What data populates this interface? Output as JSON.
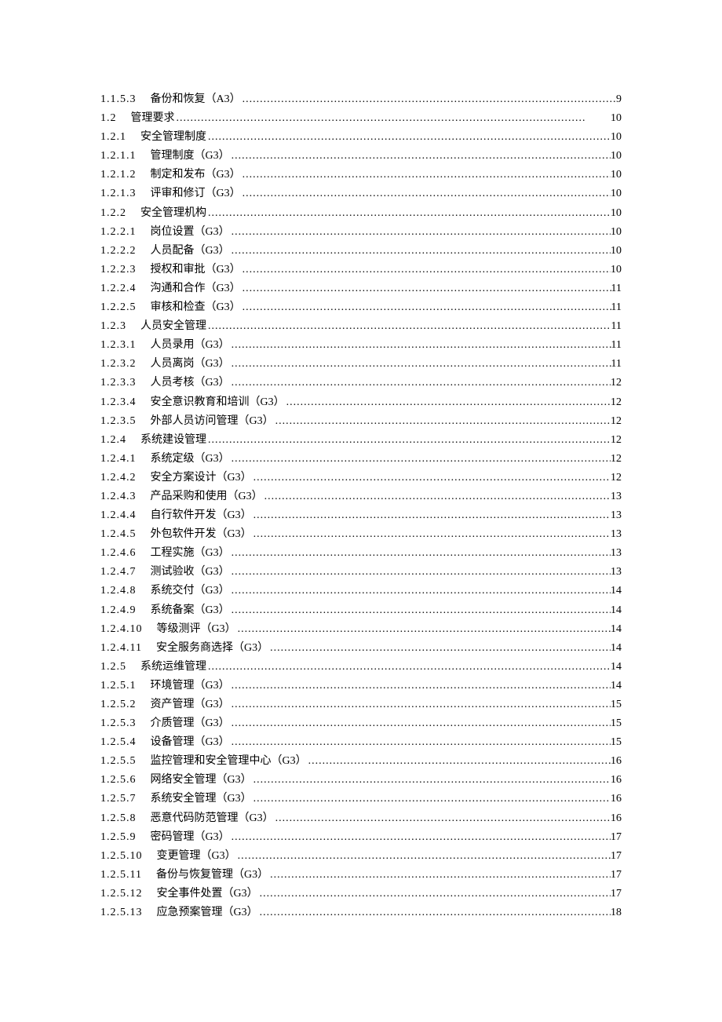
{
  "toc": [
    {
      "num": "1.1.5.3",
      "title": "备份和恢复（A3）",
      "page": "9"
    },
    {
      "num": "1.2",
      "title": "管理要求",
      "page": "10"
    },
    {
      "num": "1.2.1",
      "title": "安全管理制度",
      "page": "10"
    },
    {
      "num": "1.2.1.1",
      "title": "管理制度（G3）",
      "page": "10"
    },
    {
      "num": "1.2.1.2",
      "title": "制定和发布（G3）",
      "page": "10"
    },
    {
      "num": "1.2.1.3",
      "title": "评审和修订（G3）",
      "page": "10"
    },
    {
      "num": "1.2.2",
      "title": "安全管理机构",
      "page": "10"
    },
    {
      "num": "1.2.2.1",
      "title": "岗位设置（G3）",
      "page": "10"
    },
    {
      "num": "1.2.2.2",
      "title": "人员配备（G3）",
      "page": "10"
    },
    {
      "num": "1.2.2.3",
      "title": "授权和审批（G3）",
      "page": "10"
    },
    {
      "num": "1.2.2.4",
      "title": "沟通和合作（G3）",
      "page": "11"
    },
    {
      "num": "1.2.2.5",
      "title": "审核和检查（G3）",
      "page": "11"
    },
    {
      "num": "1.2.3",
      "title": "人员安全管理",
      "page": "11"
    },
    {
      "num": "1.2.3.1",
      "title": "人员录用（G3）",
      "page": "11"
    },
    {
      "num": "1.2.3.2",
      "title": "人员离岗（G3）",
      "page": "11"
    },
    {
      "num": "1.2.3.3",
      "title": "人员考核（G3）",
      "page": "12"
    },
    {
      "num": "1.2.3.4",
      "title": "安全意识教育和培训（G3）",
      "page": "12"
    },
    {
      "num": "1.2.3.5",
      "title": "外部人员访问管理（G3）",
      "page": "12"
    },
    {
      "num": "1.2.4",
      "title": "系统建设管理",
      "page": "12"
    },
    {
      "num": "1.2.4.1",
      "title": "系统定级（G3）",
      "page": "12"
    },
    {
      "num": "1.2.4.2",
      "title": "安全方案设计（G3）",
      "page": "12"
    },
    {
      "num": "1.2.4.3",
      "title": "产品采购和使用（G3）",
      "page": "13"
    },
    {
      "num": "1.2.4.4",
      "title": "自行软件开发（G3）",
      "page": "13"
    },
    {
      "num": "1.2.4.5",
      "title": "外包软件开发（G3）",
      "page": "13"
    },
    {
      "num": "1.2.4.6",
      "title": "工程实施（G3）",
      "page": "13"
    },
    {
      "num": "1.2.4.7",
      "title": "测试验收（G3）",
      "page": "13"
    },
    {
      "num": "1.2.4.8",
      "title": "系统交付（G3）",
      "page": "14"
    },
    {
      "num": "1.2.4.9",
      "title": "系统备案（G3）",
      "page": "14"
    },
    {
      "num": "1.2.4.10",
      "title": "等级测评（G3）",
      "page": "14"
    },
    {
      "num": "1.2.4.11",
      "title": "安全服务商选择（G3）",
      "page": "14"
    },
    {
      "num": "1.2.5",
      "title": "系统运维管理",
      "page": "14"
    },
    {
      "num": "1.2.5.1",
      "title": "环境管理（G3）",
      "page": "14"
    },
    {
      "num": "1.2.5.2",
      "title": "资产管理（G3）",
      "page": "15"
    },
    {
      "num": "1.2.5.3",
      "title": "介质管理（G3）",
      "page": "15"
    },
    {
      "num": "1.2.5.4",
      "title": "设备管理（G3）",
      "page": "15"
    },
    {
      "num": "1.2.5.5",
      "title": "监控管理和安全管理中心（G3）",
      "page": "16"
    },
    {
      "num": "1.2.5.6",
      "title": "网络安全管理（G3）",
      "page": "16"
    },
    {
      "num": "1.2.5.7",
      "title": "系统安全管理（G3）",
      "page": "16"
    },
    {
      "num": "1.2.5.8",
      "title": "恶意代码防范管理（G3）",
      "page": "16"
    },
    {
      "num": "1.2.5.9",
      "title": "密码管理（G3）",
      "page": "17"
    },
    {
      "num": "1.2.5.10",
      "title": "变更管理（G3）",
      "page": "17"
    },
    {
      "num": "1.2.5.11",
      "title": "备份与恢复管理（G3）",
      "page": "17"
    },
    {
      "num": "1.2.5.12",
      "title": "安全事件处置（G3）",
      "page": "17"
    },
    {
      "num": "1.2.5.13",
      "title": "应急预案管理（G3）",
      "page": "18"
    }
  ],
  "dots": "...................................................................................................................."
}
